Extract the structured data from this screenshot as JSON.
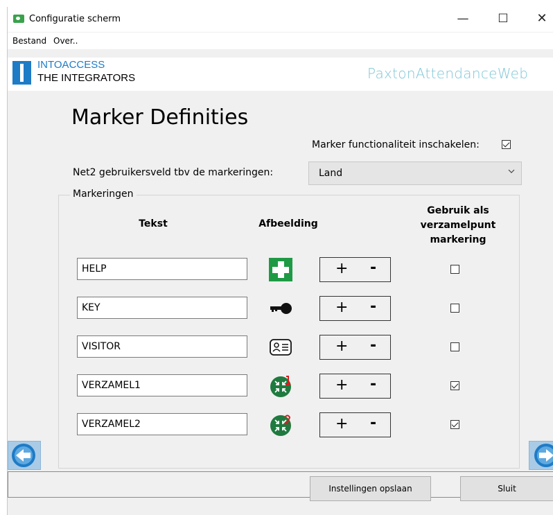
{
  "window": {
    "title": "Configuratie scherm",
    "controls": {
      "minimize": "—",
      "maximize": "☐",
      "close": "✕"
    }
  },
  "menu": {
    "items": [
      "Bestand",
      "Over.."
    ]
  },
  "branding": {
    "logo_line1": "INTOACCESS",
    "logo_line2": "THE INTEGRATORS",
    "product": "PaxtonAttendanceWeb",
    "colors": {
      "logo_blue": "#1e7bc6",
      "product_teal": "#7ec6d6"
    }
  },
  "page": {
    "title": "Marker Definities",
    "enable_label": "Marker functionaliteit inschakelen:",
    "enable_checked": true,
    "field_label": "Net2 gebruikersveld tbv de markeringen:",
    "field_value": "Land"
  },
  "markeringen": {
    "legend": "Markeringen",
    "headers": {
      "tekst": "Tekst",
      "afbeelding": "Afbeelding",
      "gebruik_line1": "Gebruik als",
      "gebruik_line2": "verzamelpunt",
      "gebruik_line3": "markering"
    },
    "plus_label": "+",
    "minus_label": "-",
    "rows": [
      {
        "text": "HELP",
        "icon": "first-aid-cross-icon",
        "verzamelpunt": false
      },
      {
        "text": "KEY",
        "icon": "key-icon",
        "verzamelpunt": false
      },
      {
        "text": "VISITOR",
        "icon": "visitor-badge-icon",
        "verzamelpunt": false
      },
      {
        "text": "VERZAMEL1",
        "icon": "assembly-point-1-icon",
        "verzamelpunt": true
      },
      {
        "text": "VERZAMEL2",
        "icon": "assembly-point-2-icon",
        "verzamelpunt": true
      }
    ]
  },
  "footer": {
    "save_button": "Instellingen opslaan",
    "close_button": "Sluit"
  }
}
